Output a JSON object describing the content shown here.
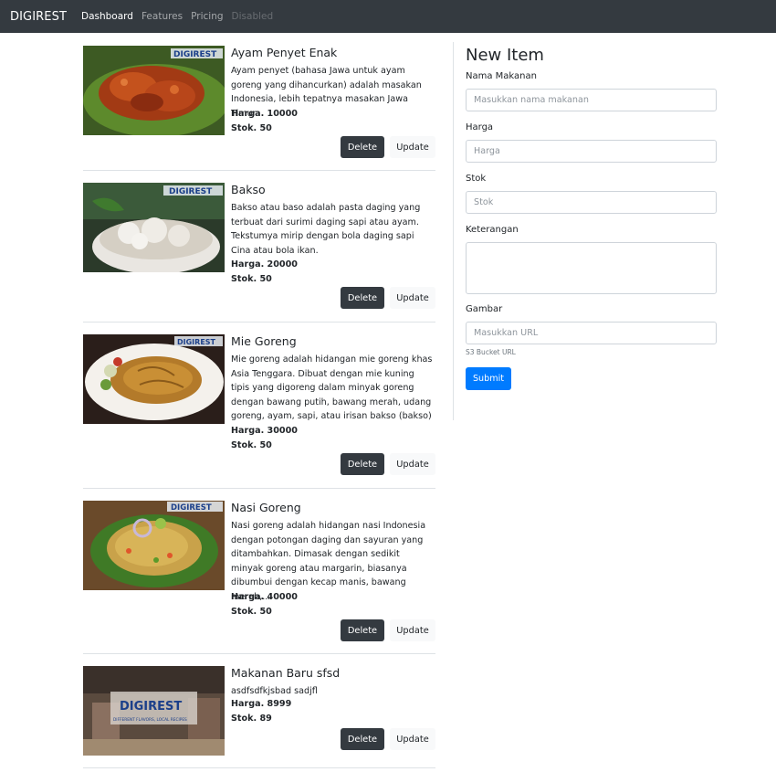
{
  "navbar": {
    "brand": "DIGIREST",
    "links": [
      {
        "label": "Dashboard"
      },
      {
        "label": "Features"
      },
      {
        "label": "Pricing"
      },
      {
        "label": "Disabled"
      }
    ]
  },
  "items": [
    {
      "title": "Ayam Penyet Enak",
      "description": "Ayam penyet (bahasa Jawa untuk ayam goreng yang dihancurkan) adalah masakan Indonesia, lebih tepatnya masakan Jawa Timur.",
      "price": "Harga. 10000",
      "stock": "Stok. 50",
      "delete_label": "Delete",
      "update_label": "Update",
      "image_watermark": "DIGIREST"
    },
    {
      "title": "Bakso",
      "description": "Bakso atau baso adalah pasta daging yang terbuat dari surimi daging sapi atau ayam. Tekstumya mirip dengan bola daging sapi Cina atau bola ikan.",
      "price": "Harga. 20000",
      "stock": "Stok. 50",
      "delete_label": "Delete",
      "update_label": "Update",
      "image_watermark": "DIGIREST"
    },
    {
      "title": "Mie Goreng",
      "description": "Mie goreng adalah hidangan mie goreng khas Asia Tenggara. Dibuat dengan mie kuning tipis yang digoreng dalam minyak goreng dengan bawang putih, bawang merah, udang goreng, ayam, sapi, atau irisan bakso (bakso)",
      "price": "Harga. 30000",
      "stock": "Stok. 50",
      "delete_label": "Delete",
      "update_label": "Update",
      "image_watermark": "DIGIREST"
    },
    {
      "title": "Nasi Goreng",
      "description": "Nasi goreng adalah hidangan nasi Indonesia dengan potongan daging dan sayuran yang ditambahkan. Dimasak dengan sedikit minyak goreng atau margarin, biasanya dibumbui dengan kecap manis, bawang merah,...",
      "price": "Harga. 40000",
      "stock": "Stok. 50",
      "delete_label": "Delete",
      "update_label": "Update",
      "image_watermark": "DIGIREST"
    },
    {
      "title": "Makanan Baru sfsd",
      "description": "asdfsdfkjsbad sadjfl",
      "price": "Harga. 8999",
      "stock": "Stok. 89",
      "delete_label": "Delete",
      "update_label": "Update",
      "image_watermark": "DIGIREST",
      "image_tagline": "DIFFERENT FLAVORS, LOCAL RECIPES"
    }
  ],
  "form": {
    "title": "New Item",
    "name_label": "Nama Makanan",
    "name_placeholder": "Masukkan nama makanan",
    "price_label": "Harga",
    "price_placeholder": "Harga",
    "stock_label": "Stok",
    "stock_placeholder": "Stok",
    "desc_label": "Keterangan",
    "image_label": "Gambar",
    "image_placeholder": "Masukkan URL",
    "image_help": "S3 Bucket URL",
    "submit_label": "Submit"
  },
  "colors": {
    "navbar_bg": "#343a40",
    "primary": "#007bff",
    "dark_button": "#343a40",
    "light_button": "#f8f9fa"
  }
}
